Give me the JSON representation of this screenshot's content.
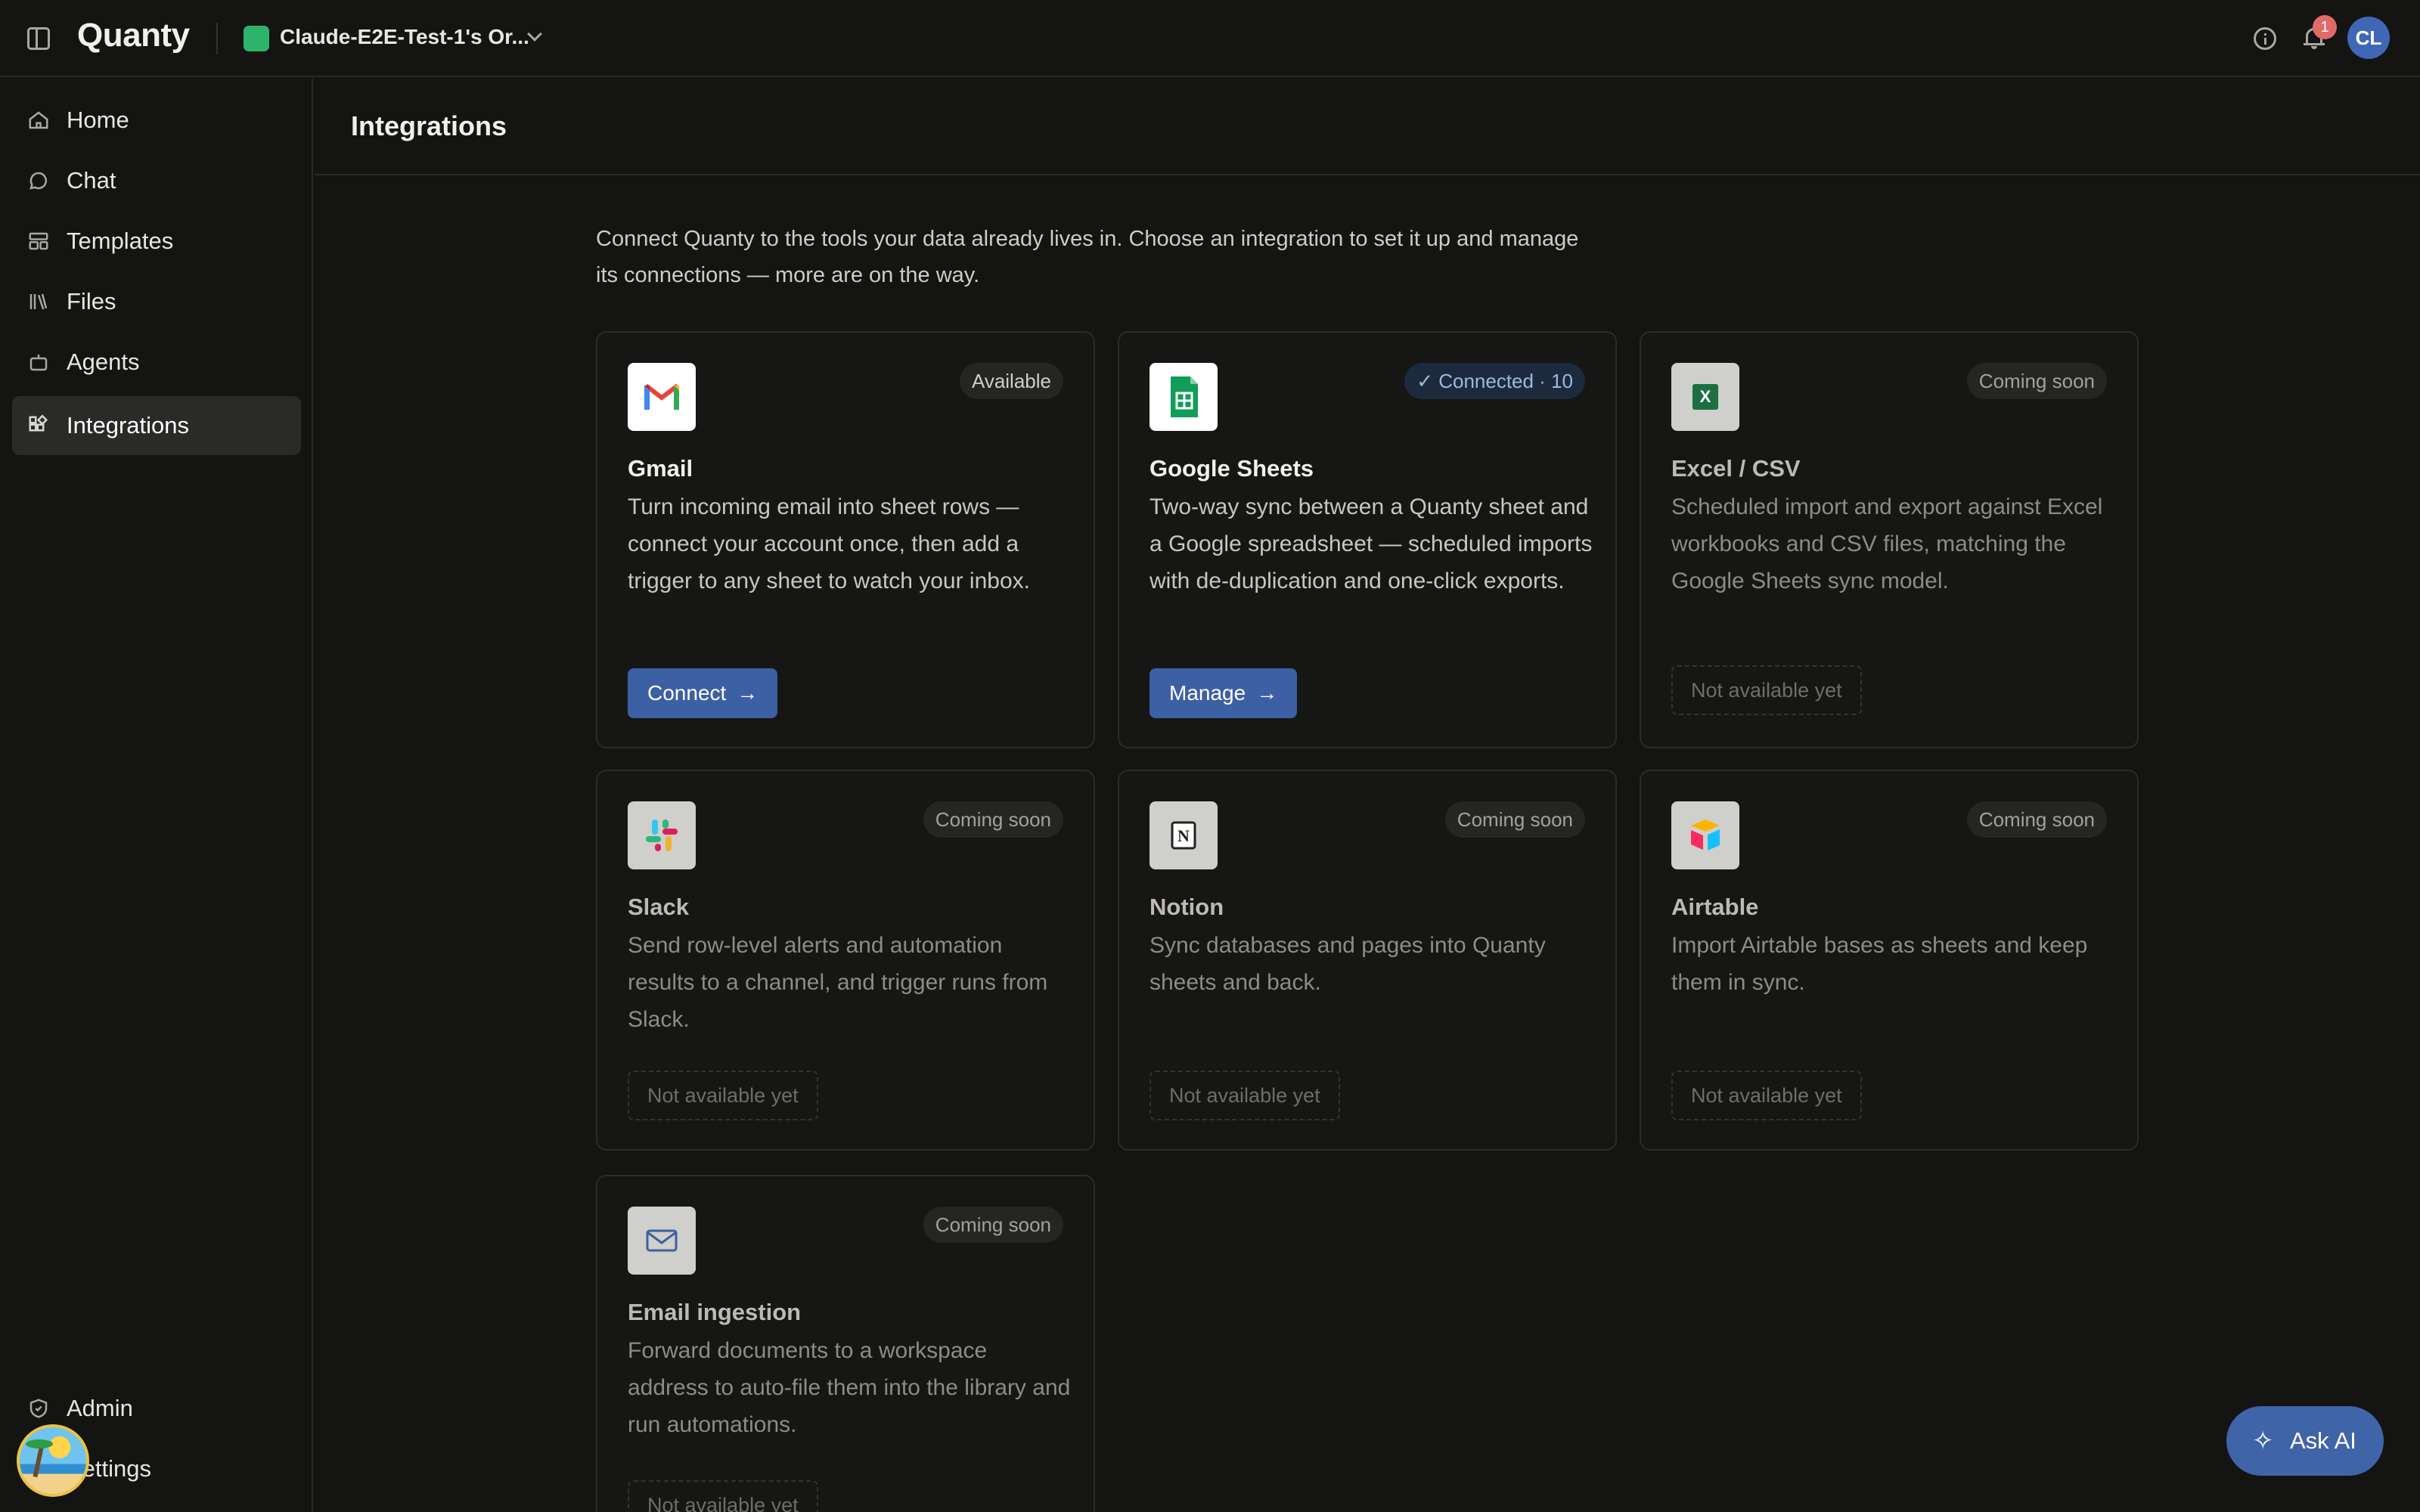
{
  "app": {
    "brand": "Quanty",
    "org_name": "Claude-E2E-Test-1's Or...",
    "org_color": "#2eb36a",
    "notification_count": "1",
    "avatar_initials": "CL"
  },
  "sidebar": {
    "items": [
      {
        "label": "Home",
        "icon": "home-icon"
      },
      {
        "label": "Chat",
        "icon": "chat-icon"
      },
      {
        "label": "Templates",
        "icon": "templates-icon"
      },
      {
        "label": "Files",
        "icon": "files-icon"
      },
      {
        "label": "Agents",
        "icon": "agents-icon"
      },
      {
        "label": "Integrations",
        "icon": "integrations-icon",
        "active": true
      }
    ],
    "bottom_items": [
      {
        "label": "Admin",
        "icon": "shield-icon"
      },
      {
        "label": "Settings",
        "icon": "gear-icon"
      }
    ]
  },
  "page": {
    "title": "Integrations",
    "intro": "Connect Quanty to the tools your data already lives in. Choose an integration to set it up and manage its connections — more are on the way."
  },
  "cards": [
    {
      "title": "Gmail",
      "badge": "Available",
      "description": "Turn incoming email into sheet rows — connect your account once, then add a trigger to any sheet to watch your inbox.",
      "action": "Connect",
      "icon": "gmail-logo"
    },
    {
      "title": "Google Sheets",
      "badge": "Connected · 10",
      "description": "Two-way sync between a Quanty sheet and a Google spreadsheet — scheduled imports with de-duplication and one-click exports.",
      "action": "Manage",
      "icon": "google-sheets-logo"
    },
    {
      "title": "Excel / CSV",
      "badge": "Coming soon",
      "description": "Scheduled import and export against Excel workbooks and CSV files, matching the Google Sheets sync model.",
      "action": "Not available yet",
      "icon": "excel-logo"
    },
    {
      "title": "Slack",
      "badge": "Coming soon",
      "description": "Send row-level alerts and automation results to a channel, and trigger runs from Slack.",
      "action": "Not available yet",
      "icon": "slack-logo"
    },
    {
      "title": "Notion",
      "badge": "Coming soon",
      "description": "Sync databases and pages into Quanty sheets and back.",
      "action": "Not available yet",
      "icon": "notion-logo"
    },
    {
      "title": "Airtable",
      "badge": "Coming soon",
      "description": "Import Airtable bases as sheets and keep them in sync.",
      "action": "Not available yet",
      "icon": "airtable-logo"
    },
    {
      "title": "Email ingestion",
      "badge": "Coming soon",
      "description": "Forward documents to a workspace address to auto-file them into the library and run automations.",
      "action": "Not available yet",
      "icon": "mail-icon"
    }
  ],
  "ask_ai": {
    "label": "Ask AI"
  },
  "colors": {
    "accent": "#3d5fa3",
    "background": "#141412",
    "connected_badge": "#9db8e2"
  }
}
